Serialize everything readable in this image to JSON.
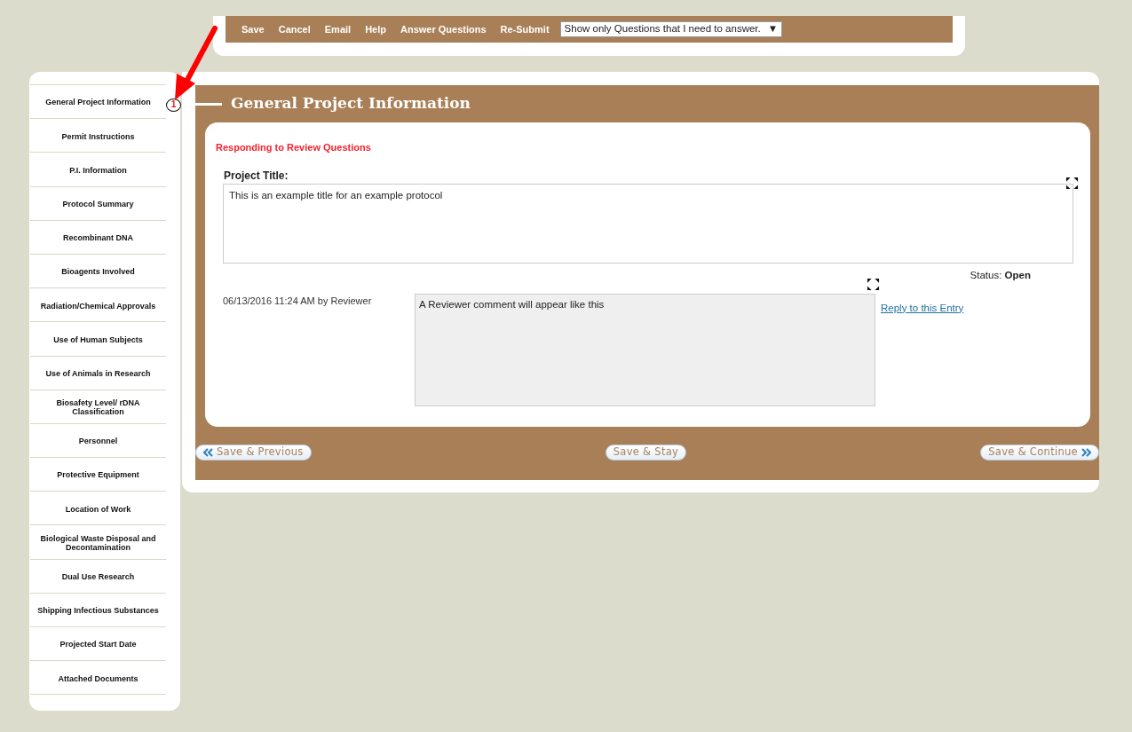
{
  "toolbar": {
    "buttons": [
      "Save",
      "Cancel",
      "Email",
      "Help",
      "Answer Questions",
      "Re-Submit"
    ],
    "filter": {
      "value": "Show only Questions that I need to answer.",
      "arrow": "▼"
    }
  },
  "sidebar": {
    "items": [
      {
        "label": "General Project Information",
        "comments": "1"
      },
      {
        "label": "Permit Instructions"
      },
      {
        "label": "P.I. Information"
      },
      {
        "label": "Protocol Summary"
      },
      {
        "label": "Recombinant DNA"
      },
      {
        "label": "Bioagents Involved"
      },
      {
        "label": "Radiation/Chemical Approvals"
      },
      {
        "label": "Use of Human Subjects"
      },
      {
        "label": "Use of Animals in Research"
      },
      {
        "label": "Biosafety Level/ rDNA Classification"
      },
      {
        "label": "Personnel"
      },
      {
        "label": "Protective Equipment"
      },
      {
        "label": "Location of Work"
      },
      {
        "label": "Biological Waste Disposal and Decontamination"
      },
      {
        "label": "Dual Use Research"
      },
      {
        "label": "Shipping Infectious Substances"
      },
      {
        "label": "Projected Start Date"
      },
      {
        "label": "Attached Documents"
      }
    ]
  },
  "section": {
    "title": "General Project Information",
    "notice": "Responding to Review Questions",
    "field": {
      "label": "Project Title:",
      "value": "This is an example title for an example protocol"
    },
    "status": {
      "label": "Status:",
      "value": "Open"
    },
    "comment": {
      "date": "06/13/2016 11:24 AM",
      "author": "by Reviewer",
      "text": "A Reviewer comment will appear like this",
      "reply": "Reply to this Entry"
    }
  },
  "nav": {
    "previous": "Save & Previous",
    "stay": "Save & Stay",
    "next": "Save & Continue"
  }
}
